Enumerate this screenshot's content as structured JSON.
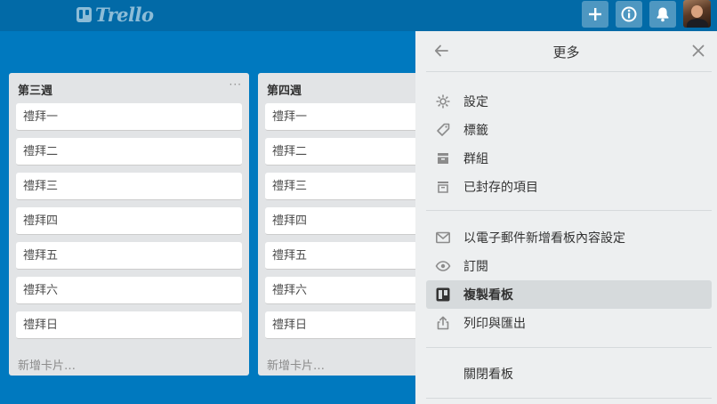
{
  "header": {
    "logo_text": "Trello",
    "buttons": [
      {
        "icon": "plus-icon"
      },
      {
        "icon": "info-icon"
      },
      {
        "icon": "bell-icon"
      }
    ],
    "avatar": "user-avatar"
  },
  "lists": [
    {
      "title": "第三週",
      "menu": "···",
      "cards": [
        "禮拜一",
        "禮拜二",
        "禮拜三",
        "禮拜四",
        "禮拜五",
        "禮拜六",
        "禮拜日"
      ],
      "add_card": "新增卡片…"
    },
    {
      "title": "第四週",
      "cards": [
        "禮拜一",
        "禮拜二",
        "禮拜三",
        "禮拜四",
        "禮拜五",
        "禮拜六",
        "禮拜日"
      ],
      "add_card": "新增卡片…"
    }
  ],
  "panel": {
    "title": "更多",
    "back_icon": "arrow-left-icon",
    "close_icon": "close-icon",
    "group1": [
      {
        "label": "設定",
        "icon": "gear-icon"
      },
      {
        "label": "標籤",
        "icon": "tag-icon"
      },
      {
        "label": "群組",
        "icon": "archive-box-icon"
      },
      {
        "label": "已封存的項目",
        "icon": "archived-items-icon"
      }
    ],
    "group2": [
      {
        "label": "以電子郵件新增看板內容設定",
        "icon": "envelope-icon"
      },
      {
        "label": "訂閱",
        "icon": "eye-icon"
      },
      {
        "label": "複製看板",
        "icon": "board-icon",
        "active": true
      },
      {
        "label": "列印與匯出",
        "icon": "share-icon"
      }
    ],
    "close_board": "關閉看板"
  },
  "colors": {
    "board_bg": "#0079bf",
    "header_bg": "#026aa7",
    "panel_bg": "#edeff0",
    "list_bg": "#e2e4e6"
  }
}
